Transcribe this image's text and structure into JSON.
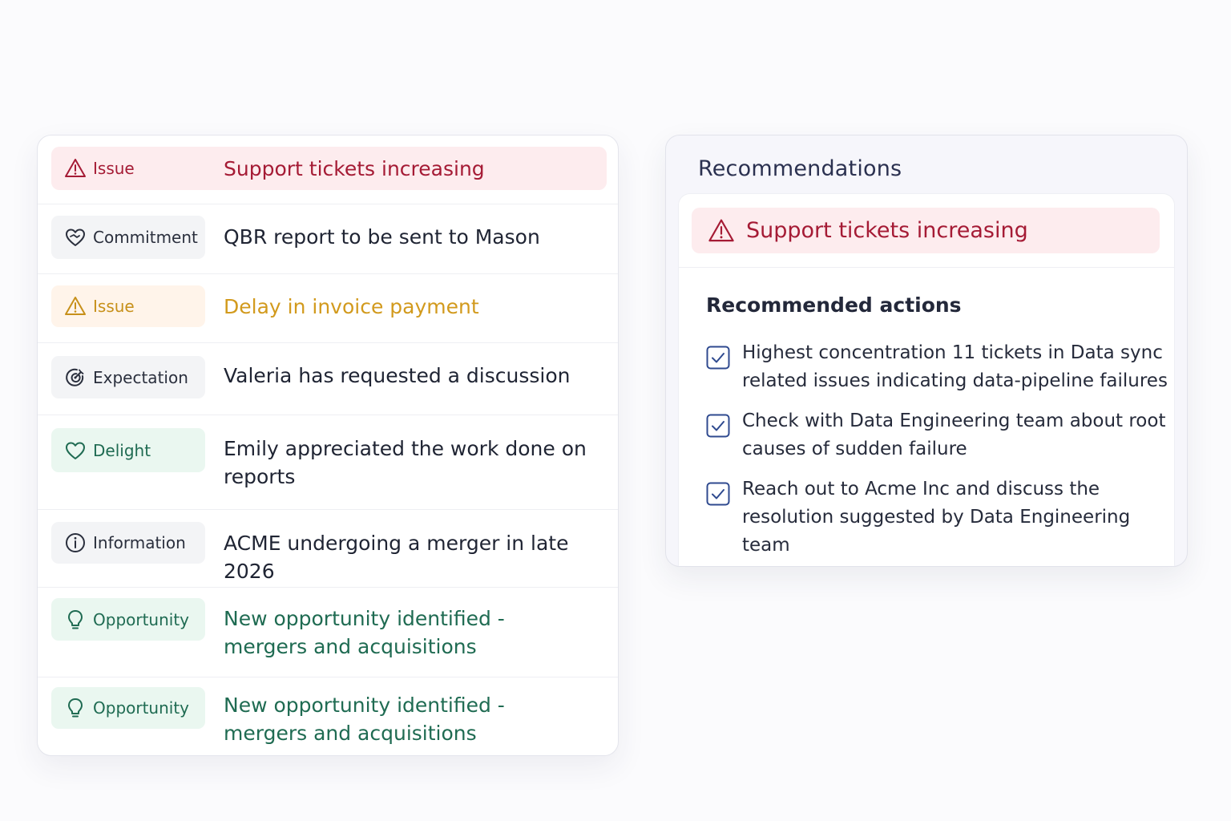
{
  "signals": [
    {
      "tag": "Issue",
      "text": "Support tickets increasing",
      "icon": "warning-icon",
      "tone": "red"
    },
    {
      "tag": "Commitment",
      "text": "QBR report to be sent to Mason",
      "icon": "handshake-heart-icon",
      "tone": "gray"
    },
    {
      "tag": "Issue",
      "text": "Delay in invoice payment",
      "icon": "warning-icon",
      "tone": "orange"
    },
    {
      "tag": "Expectation",
      "text": "Valeria has requested a discussion",
      "icon": "target-icon",
      "tone": "gray"
    },
    {
      "tag": "Delight",
      "text": "Emily appreciated the work done on reports",
      "icon": "heart-icon",
      "tone": "green"
    },
    {
      "tag": "Information",
      "text": "ACME undergoing a merger in late 2026",
      "icon": "info-icon",
      "tone": "gray"
    },
    {
      "tag": "Opportunity",
      "text": "New opportunity identified - mergers and acquisitions",
      "icon": "lightbulb-icon",
      "tone": "green"
    },
    {
      "tag": "Opportunity",
      "text": "New opportunity identified - mergers and acquisitions",
      "icon": "lightbulb-icon",
      "tone": "green"
    }
  ],
  "recommendations": {
    "title": "Recommendations",
    "banner": "Support tickets increasing",
    "banner_icon": "warning-icon",
    "actions_title": "Recommended actions",
    "actions": [
      {
        "text": "Highest concentration 11 tickets in Data sync related issues indicating data-pipeline failures",
        "checked": true
      },
      {
        "text": "Check with Data Engineering team about root causes of sudden failure",
        "checked": true
      },
      {
        "text": "Reach out to Acme Inc and discuss the resolution suggested by Data Engineering team",
        "checked": true
      }
    ]
  },
  "colors": {
    "issue_red": "#a51b35",
    "issue_orange": "#d29a1d",
    "opportunity_green": "#1f6b52",
    "checkbox_blue": "#2f4a8f"
  }
}
